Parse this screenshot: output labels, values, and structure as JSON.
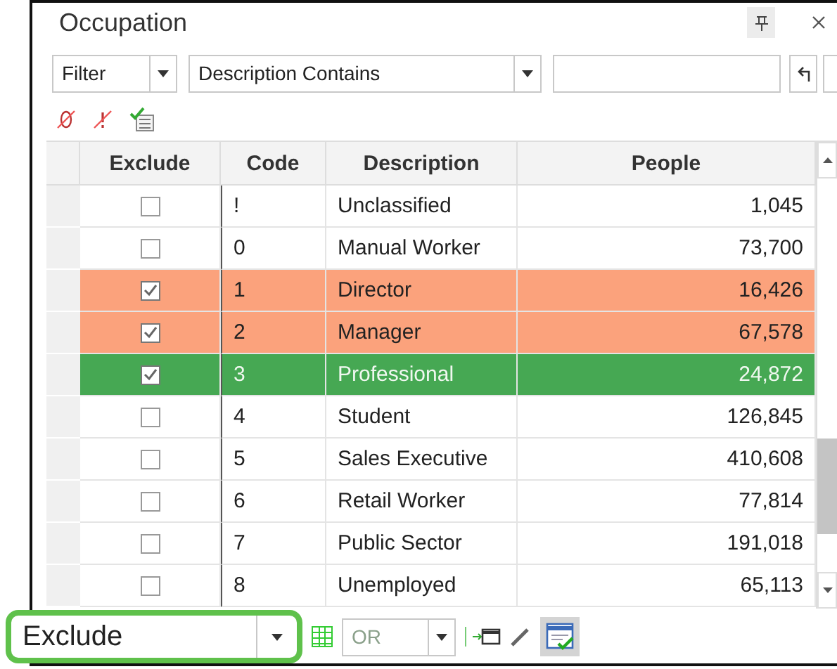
{
  "panel": {
    "title": "Occupation"
  },
  "filter_bar": {
    "mode": "Filter",
    "condition": "Description Contains"
  },
  "grid": {
    "columns": [
      "Exclude",
      "Code",
      "Description",
      "People"
    ],
    "rows": [
      {
        "excluded": false,
        "selected": false,
        "code": "!",
        "description": "Unclassified",
        "people": "1,045"
      },
      {
        "excluded": false,
        "selected": false,
        "code": "0",
        "description": "Manual Worker",
        "people": "73,700"
      },
      {
        "excluded": true,
        "selected": false,
        "code": "1",
        "description": "Director",
        "people": "16,426"
      },
      {
        "excluded": true,
        "selected": false,
        "code": "2",
        "description": "Manager",
        "people": "67,578"
      },
      {
        "excluded": true,
        "selected": true,
        "code": "3",
        "description": "Professional",
        "people": "24,872"
      },
      {
        "excluded": false,
        "selected": false,
        "code": "4",
        "description": "Student",
        "people": "126,845"
      },
      {
        "excluded": false,
        "selected": false,
        "code": "5",
        "description": "Sales Executive",
        "people": "410,608"
      },
      {
        "excluded": false,
        "selected": false,
        "code": "6",
        "description": "Retail Worker",
        "people": "77,814"
      },
      {
        "excluded": false,
        "selected": false,
        "code": "7",
        "description": "Public Sector",
        "people": "191,018"
      },
      {
        "excluded": false,
        "selected": false,
        "code": "8",
        "description": "Unemployed",
        "people": "65,113"
      }
    ]
  },
  "bottom_bar": {
    "mode": "Exclude",
    "operator": {
      "value": "OR",
      "disabled": true
    }
  }
}
